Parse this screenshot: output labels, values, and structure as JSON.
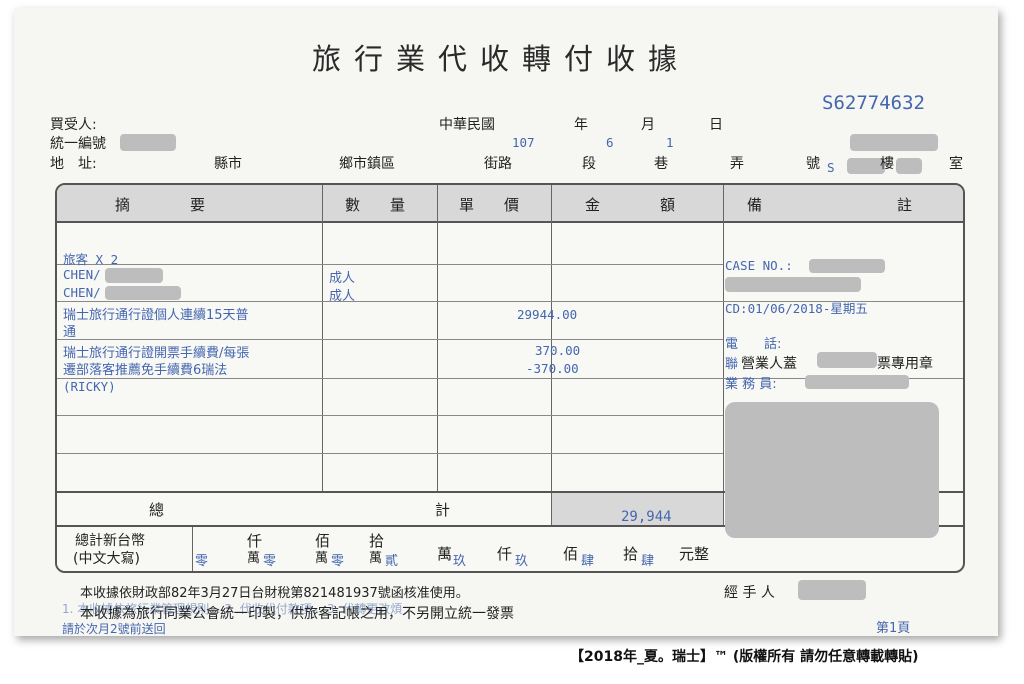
{
  "title": "旅行業代收轉付收據",
  "serial": "S62774632",
  "header": {
    "buyer_label": "買受人:",
    "tax_id_label": "統一編號",
    "address_label": "地　址:",
    "date_label_country": "中華民國",
    "date_label_year": "年",
    "date_label_month": "月",
    "date_label_day": "日",
    "date_year": "107",
    "date_month": "6",
    "date_day": "1",
    "addr_county": "縣市",
    "addr_town": "鄉市鎮區",
    "addr_street": "街路",
    "addr_section": "段",
    "addr_lane": "巷",
    "addr_alley": "弄",
    "addr_number": "號",
    "addr_number_val": "S",
    "addr_floor": "樓",
    "addr_room": "室"
  },
  "columns": {
    "summary": "摘　　　　要",
    "quantity": "數　　量",
    "unit_price": "單　　價",
    "amount": "金　　　　額",
    "remarks": "備　　　　　　　　　註"
  },
  "items": {
    "travelers": "旅客 X 2",
    "traveler1": "CHEN/",
    "traveler2": "CHEN/",
    "qty1": "成人",
    "qty2": "成人",
    "pass_line1": "瑞士旅行通行證個人連續15天普",
    "pass_line2": "通",
    "pass_price": "29944.00",
    "fee_line1": "瑞士旅行通行證開票手續費/每張",
    "fee_line2": "遷部落客推薦免手續費6瑞法",
    "fee_line3": "(RICKY)",
    "fee_price": "370.00",
    "fee_discount": "-370.00"
  },
  "remarks": {
    "case_no": "CASE NO.:",
    "cd": "CD:01/06/2018-星期五",
    "phone": "電　　話:",
    "stamp_prefix": "營業人蓋",
    "stamp_suffix": "票專用章",
    "contact_char": "聯",
    "staff": "業 務 員:"
  },
  "totals": {
    "total_label_a": "總",
    "total_label_b": "計",
    "total_value": "29,944",
    "twd_label_line1": "總計新台幣",
    "twd_label_line2": "(中文大寫)",
    "units": [
      "仟",
      "佰",
      "拾",
      "萬",
      "仟",
      "佰",
      "拾",
      "元整"
    ],
    "units_lower": [
      "萬",
      "萬",
      "萬"
    ],
    "digits": [
      "零",
      "零",
      "零",
      "貳",
      "玖",
      "玖",
      "肆",
      "肆"
    ]
  },
  "footer": {
    "approval": "本收據依財政部82年3月27日台財稅第821481937號函核准使用。",
    "handler": "經 手 人",
    "assoc": "本收據為旅行同業公會統一印製，供旅客記帳之用，不另開立統一發票",
    "notes_line1": "1. 本收據依旅行業管理規則...  2. 代收代付款項... 3. 代轉更改煩",
    "notes_line2": "請於次月2號前送回",
    "page": "第1頁"
  },
  "watermark": "【2018年_夏。瑞士】™ (版權所有 請勿任意轉載轉貼)"
}
